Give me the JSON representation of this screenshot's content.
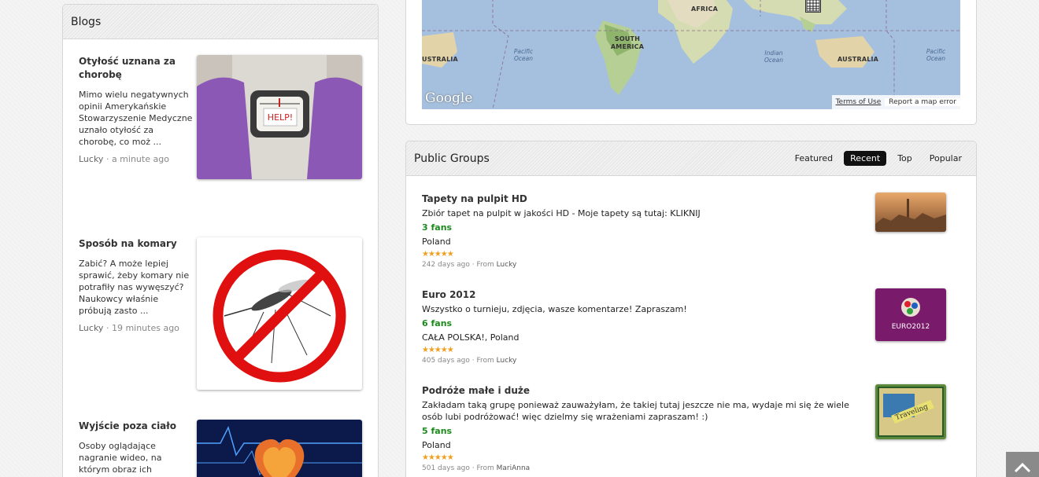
{
  "blogs": {
    "title": "Blogs",
    "entries": [
      {
        "title": "Otyłość uznana za chorobę",
        "excerpt": "Mimo wielu negatywnych opinii Amerykańskie Stowarzyszenie Medyczne uznało otyłość za chorobę, co moż ...",
        "author": "Lucky",
        "time": "· a minute ago",
        "image_text": "HELP!"
      },
      {
        "title": "Sposób na komary",
        "excerpt": "Zabić? A może lepiej sprawić, żeby komary nie potrafiły nas wywęszyć? Naukowcy właśnie próbują zasto ...",
        "author": "Lucky",
        "time": "· 19 minutes ago"
      },
      {
        "title": "Wyjście poza ciało",
        "excerpt": "Osoby oglądające nagranie wideo, na którym obraz ich"
      }
    ]
  },
  "map": {
    "labels": [
      "AFRICA",
      "SOUTH AMERICA",
      "USTRALIA",
      "AUSTRALIA"
    ],
    "oceans": [
      "Pacific Ocean",
      "Indian Ocean",
      "Pacific Ocean"
    ],
    "logo": "Google",
    "terms": "Terms of Use",
    "report": "Report a map error"
  },
  "groups": {
    "title": "Public Groups",
    "tabs": [
      "Featured",
      "Recent",
      "Top",
      "Popular"
    ],
    "active_tab": "Recent",
    "items": [
      {
        "title": "Tapety na pulpit HD",
        "desc": "Zbiór tapet na pulpit w jakości HD - Moje tapety są tutaj: KLIKNIJ",
        "fans": "3 fans",
        "location": "Poland",
        "stars": "★★★★★",
        "age": "242 days ago · From",
        "user": "Lucky"
      },
      {
        "title": "Euro 2012",
        "desc": "Wszystko o turnieju, zdjęcia, wasze komentarze! Zapraszam!",
        "fans": "6 fans",
        "location": "CAŁA POLSKA!, Poland",
        "stars": "★★★★★",
        "age": "405 days ago · From",
        "user": "Lucky",
        "image_text": "EURO2012"
      },
      {
        "title": "Podróże małe i duże",
        "desc": "Zakładam taką grupę ponieważ zauważyłam, że takiej tutaj jeszcze nie ma, wydaje mi się że wiele osób lubi podróżować! więc dzielmy się wrażeniami zapraszam! :)",
        "fans": "5 fans",
        "location": "Poland",
        "stars": "★★★★★",
        "age": "501 days ago · From",
        "user": "MariAnna",
        "image_text": "Traveling"
      }
    ]
  },
  "icons": {
    "scroll_top": "chevron-up-icon",
    "map_grid": "grid-icon"
  },
  "colors": {
    "fans": "#1c8a1c",
    "stars": "#f0a020",
    "active_tab": "#111111",
    "map_water": "#a5c0de"
  }
}
